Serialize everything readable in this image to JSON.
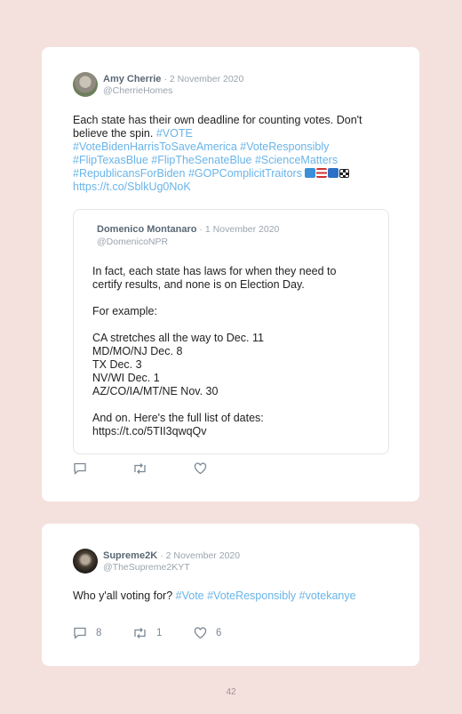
{
  "tweet1": {
    "name": "Amy Cherrie",
    "date": "· 2 November 2020",
    "handle": "@CherrieHomes",
    "text_plain": "Each state has their own deadline for counting votes. Don't believe the spin.",
    "hashtags_line1": "#VOTE",
    "hashtags_line2": "#VoteBidenHarrisToSaveAmerica #VoteResponsibly",
    "hashtags_line3": "#FlipTexasBlue #FlipTheSenateBlue #ScienceMatters",
    "hashtags_line4": "#RepublicansForBiden #GOPComplicitTraitors",
    "url": "https://t.co/SblkUg0NoK",
    "quote": {
      "name": "Domenico Montanaro",
      "date": "· 1 November 2020",
      "handle": "@DomenicoNPR",
      "lines": [
        "In fact, each state has laws for when they need to",
        "certify results, and none is on Election Day.",
        "For example:",
        "CA stretches all the way to Dec. 11",
        "MD/MO/NJ Dec. 8",
        "TX Dec. 3",
        "NV/WI Dec. 1",
        "AZ/CO/IA/MT/NE Nov. 30",
        "And on. Here's the full list of dates:"
      ],
      "url": "https://t.co/5TII3qwqQv"
    },
    "icons": [
      "comment-icon",
      "retweet-icon",
      "like-icon"
    ]
  },
  "tweet2": {
    "name": "Supreme2K",
    "date": "· 2 November 2020",
    "handle": "@TheSupreme2KYT",
    "text_plain": "Who y'all voting for?",
    "hashtags": "#Vote #VoteResponsibly #votekanye",
    "replies": "8",
    "retweets": "1",
    "likes": "6"
  },
  "page_number": "42"
}
